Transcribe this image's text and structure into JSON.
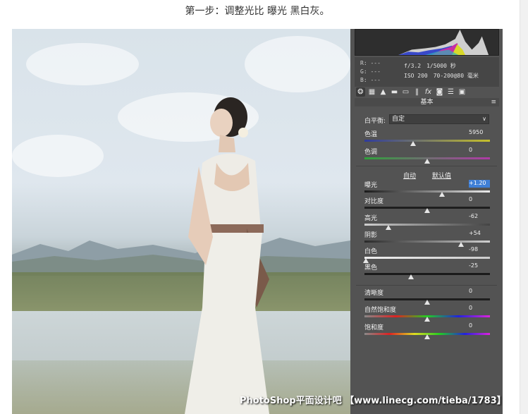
{
  "caption": "第一步：调整光比 曝光 黑白灰。",
  "info": {
    "r": "R:  ---",
    "g": "G:  ---",
    "b": "B:  ---",
    "aperture": "f/3.2",
    "shutter": "1/5000 秒",
    "iso": "ISO 200",
    "lens": "70-200@80 毫米"
  },
  "panel": {
    "title": "基本",
    "menu_icon": "≡",
    "tools": [
      "aperture-icon",
      "grid-icon",
      "mountain-icon",
      "split-icon",
      "panel-icon",
      "barcode-icon",
      "fx-icon",
      "camera-icon",
      "sliders-icon",
      "stack-icon"
    ]
  },
  "white_balance": {
    "label": "白平衡:",
    "value": "自定"
  },
  "links": {
    "auto": "自动",
    "default": "默认值"
  },
  "sliders": [
    {
      "label": "色温",
      "value": "5950",
      "level": 0.39,
      "track": "linear-gradient(90deg,#2f3b9c,#c6c02b)"
    },
    {
      "label": "色调",
      "value": "0",
      "level": 0.5,
      "track": "linear-gradient(90deg,#2fa23b,#b03aa7)"
    },
    {
      "label": "曝光",
      "value": "+1.20",
      "level": 0.62,
      "selected": true,
      "track": "linear-gradient(90deg,#1a1a1a,#eaeaea)"
    },
    {
      "label": "对比度",
      "value": "0",
      "level": 0.5,
      "track": "#1e1e1e"
    },
    {
      "label": "高光",
      "value": "-62",
      "level": 0.19,
      "track": "linear-gradient(90deg,#cfcfcf,#444)"
    },
    {
      "label": "阴影",
      "value": "+54",
      "level": 0.77,
      "track": "linear-gradient(90deg,#2a2a2a,#cfcfcf)"
    },
    {
      "label": "白色",
      "value": "-98",
      "level": 0.01,
      "track": "linear-gradient(90deg,#eeeeee,#cccccc)"
    },
    {
      "label": "黑色",
      "value": "-25",
      "level": 0.37,
      "track": "#1b1b1b"
    },
    {
      "label": "清晰度",
      "value": "0",
      "level": 0.5,
      "track": "#1e1e1e"
    },
    {
      "label": "自然饱和度",
      "value": "0",
      "level": 0.5,
      "track": "linear-gradient(90deg,#888,#d22,#2c2,#22d,#d2d)"
    },
    {
      "label": "饱和度",
      "value": "0",
      "level": 0.5,
      "track": "linear-gradient(90deg,#888,#d22,#dd2,#2c2,#22d,#d2d)"
    }
  ],
  "watermark": "PhotoShop平面设计吧 【www.linecg.com/tieba/1783】"
}
